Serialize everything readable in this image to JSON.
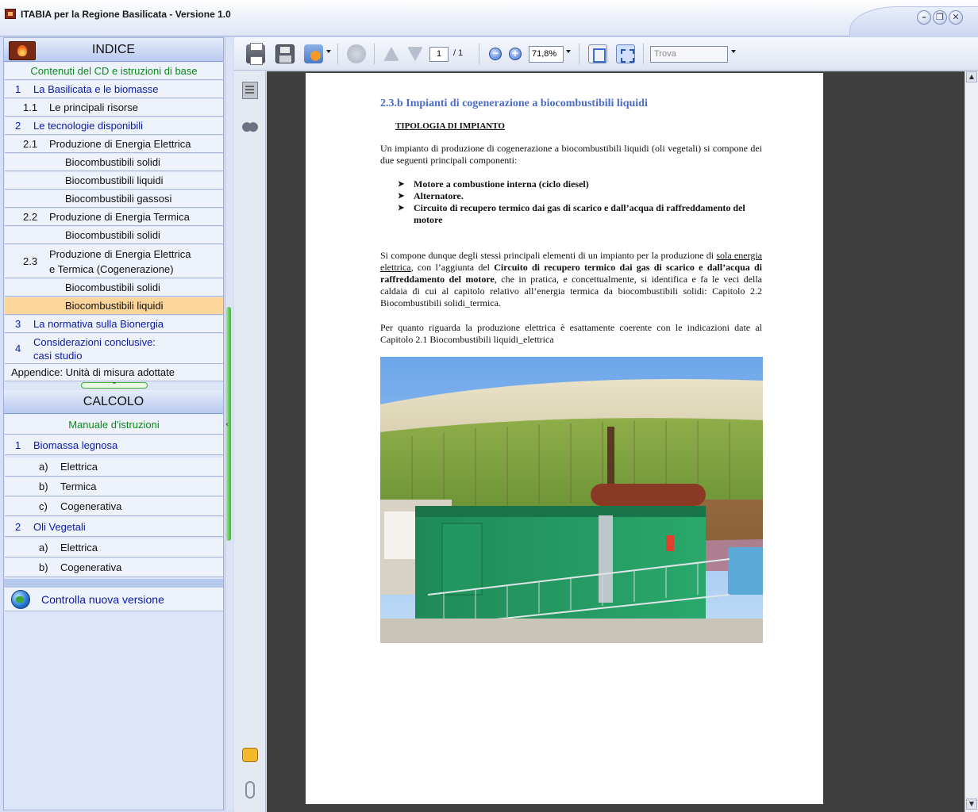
{
  "window": {
    "title": "ITABIA per la Regione Basilicata  -  Versione 1.0",
    "minimize_glyph": "–",
    "restore_glyph": "❐",
    "close_glyph": "✕"
  },
  "sidebar": {
    "indice_header": "INDICE",
    "items": [
      {
        "num": "",
        "label": "Contenuti del CD e istruzioni di base"
      },
      {
        "num": "1",
        "label": "La Basilicata e le biomasse"
      },
      {
        "num": "1.1",
        "label": "Le principali risorse"
      },
      {
        "num": "2",
        "label": "Le tecnologie disponibili"
      },
      {
        "num": "2.1",
        "label": "Produzione di Energia Elettrica"
      },
      {
        "num": "",
        "label": "Biocombustibili solidi"
      },
      {
        "num": "",
        "label": "Biocombustibili liquidi"
      },
      {
        "num": "",
        "label": "Biocombustibili gassosi"
      },
      {
        "num": "2.2",
        "label": "Produzione di Energia Termica"
      },
      {
        "num": "",
        "label": "Biocombustibili solidi"
      },
      {
        "num": "2.3",
        "label": "Produzione di Energia Elettrica",
        "label2": "e Termica (Cogenerazione)"
      },
      {
        "num": "",
        "label": "Biocombustibili solidi"
      },
      {
        "num": "",
        "label": "Biocombustibili liquidi"
      },
      {
        "num": "3",
        "label": "La normativa sulla Bionergia"
      },
      {
        "num": "4",
        "label": "Considerazioni conclusive:",
        "label2": "casi studio"
      },
      {
        "num": "",
        "label": "Appendice: Unità di misura adottate"
      }
    ],
    "calcolo_header": "CALCOLO",
    "calcolo_items": [
      {
        "num": "",
        "label": "Manuale d'istruzioni"
      },
      {
        "num": "1",
        "label": "Biomassa legnosa"
      },
      {
        "num": "a)",
        "label": "Elettrica"
      },
      {
        "num": "b)",
        "label": "Termica"
      },
      {
        "num": "c)",
        "label": "Cogenerativa"
      },
      {
        "num": "2",
        "label": "Oli Vegetali"
      },
      {
        "num": "a)",
        "label": "Elettrica"
      },
      {
        "num": "b)",
        "label": "Cogenerativa"
      }
    ],
    "update_label": "Controlla nuova versione",
    "collapse_glyph": "⌃",
    "splitter_glyph": "‹"
  },
  "viewer": {
    "page_current": "1",
    "page_total": "/ 1",
    "zoom_value": "71,8%",
    "zoom_out_glyph": "−",
    "zoom_in_glyph": "+",
    "search_placeholder": "Trova",
    "scroll_up_glyph": "▲",
    "scroll_down_glyph": "▼"
  },
  "document": {
    "heading": "2.3.b Impianti di cogenerazione a biocombustibili liquidi",
    "subheading": "TIPOLOGIA DI IMPIANTO",
    "intro": "Un impianto di produzione di cogenerazione a biocombustibili liquidi (oli vegetali) si compone dei due seguenti principali componenti:",
    "bullets": [
      "Motore a combustione interna (ciclo diesel)",
      "Alternatore.",
      "Circuito di recupero termico dai gas di scarico e dall’acqua di raffreddamento del motore"
    ],
    "para2_a": "Si compone dunque degli stessi principali elementi di un impianto per la produzione di ",
    "para2_u": "sola energia elettrica",
    "para2_b": ", con l’aggiunta del ",
    "para2_bold": "Circuito di recupero termico  dai gas di scarico e dall’acqua di raffreddamento del motore",
    "para2_c": ", che in pratica, e concettualmente, si identifica e fa le veci della caldaia di cui al capitolo relativo all’energia termica da biocombustibili solidi: Capitolo 2.2 Biocombustibili solidi_termica.",
    "para3": "Per quanto riguarda la produzione elettrica è esattamente coerente con le indicazioni date al Capitolo 2.1 Biocombustibili liquidi_elettrica"
  },
  "colors": {
    "accent_blue": "#0a1aa8",
    "accent_green": "#0a8a1a",
    "selected_row": "#fbd59a",
    "heading_blue": "#4a6bc8"
  }
}
